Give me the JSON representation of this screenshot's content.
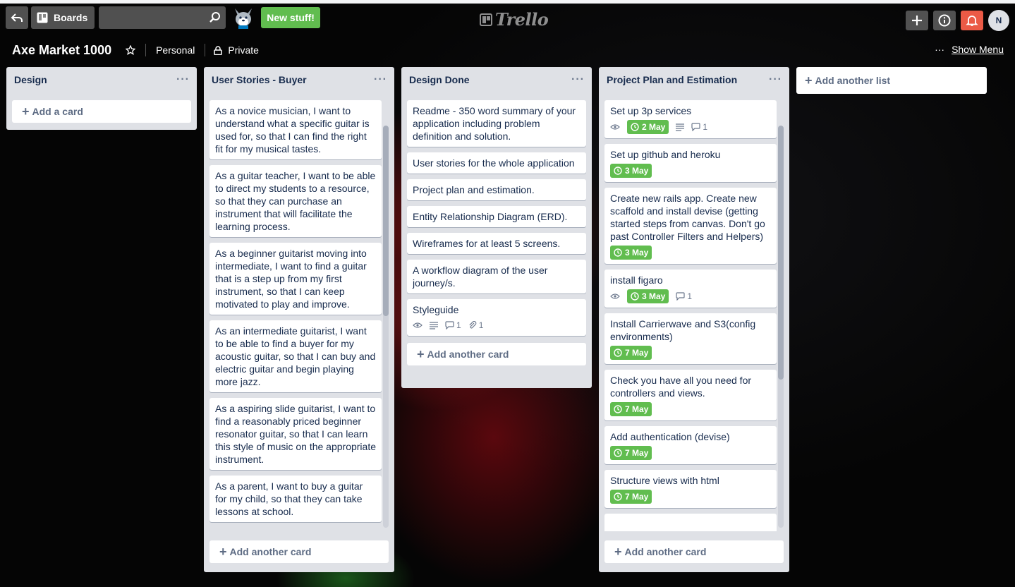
{
  "header": {
    "boards_label": "Boards",
    "search_placeholder": "",
    "new_stuff_label": "New stuff!",
    "logo_text": "Trello",
    "avatar_initial": "N"
  },
  "board": {
    "title": "Axe Market 1000",
    "team": "Personal",
    "visibility": "Private",
    "menu_dots": "···",
    "show_menu_label": "Show Menu"
  },
  "lists": [
    {
      "title": "Design",
      "menu": "···",
      "add_card_label": "Add a card",
      "cards": []
    },
    {
      "title": "User Stories - Buyer",
      "menu": "···",
      "add_card_label": "Add another card",
      "cards": [
        {
          "text": "As a novice musician, I want to understand what a specific guitar is used for, so that I can find the right fit for my musical tastes."
        },
        {
          "text": "As a guitar teacher, I want to be able to direct my students to a resource, so that they can purchase an instrument that will facilitate the learning process."
        },
        {
          "text": "As a beginner guitarist moving into intermediate, I want to find a guitar that is a step up from my first instrument, so that I can keep motivated to play and improve."
        },
        {
          "text": "As an intermediate guitarist, I want to be able to find a buyer for my acoustic guitar, so that I can buy and electric guitar and begin playing more jazz."
        },
        {
          "text": "As a aspiring slide guitarist, I want to find a reasonably priced beginner resonator guitar, so that I can learn this style of music on the appropriate instrument."
        },
        {
          "text": "As a parent, I want to buy a guitar for my child, so that they can take lessons at school."
        }
      ]
    },
    {
      "title": "Design Done",
      "menu": "···",
      "add_card_label": "Add another card",
      "cards": [
        {
          "text": "Readme - 350 word summary of your application including problem definition and solution."
        },
        {
          "text": "User stories for the whole application"
        },
        {
          "text": "Project plan and estimation."
        },
        {
          "text": "Entity Relationship Diagram (ERD)."
        },
        {
          "text": "Wireframes for at least 5 screens."
        },
        {
          "text": "A workflow diagram of the user journey/s."
        },
        {
          "text": "Styleguide",
          "comments": "1",
          "attachments": "1"
        }
      ]
    },
    {
      "title": "Project Plan and Estimation",
      "menu": "···",
      "add_card_label": "Add another card",
      "cards": [
        {
          "text": "Set up 3p services",
          "due": "2 May",
          "comments": "1"
        },
        {
          "text": "Set up github and heroku",
          "due": "3 May"
        },
        {
          "text": "Create new rails app. Create new scaffold and install devise (getting started steps from canvas. Don't go past Controller Filters and Helpers)",
          "due": "3 May"
        },
        {
          "text": "install figaro",
          "due": "3 May",
          "comments": "1"
        },
        {
          "text": "Install Carrierwave and S3(config environments)",
          "due": "7 May"
        },
        {
          "text": "Check you have all you need for controllers and views.",
          "due": "7 May"
        },
        {
          "text": "Add authentication (devise)",
          "due": "7 May"
        },
        {
          "text": "Structure views with html",
          "due": "7 May"
        }
      ]
    }
  ],
  "add_list_label": "Add another list",
  "colors": {
    "due_green": "#61bd4f",
    "list_bg": "#dfe1e6",
    "notification_red": "#eb5a46"
  }
}
